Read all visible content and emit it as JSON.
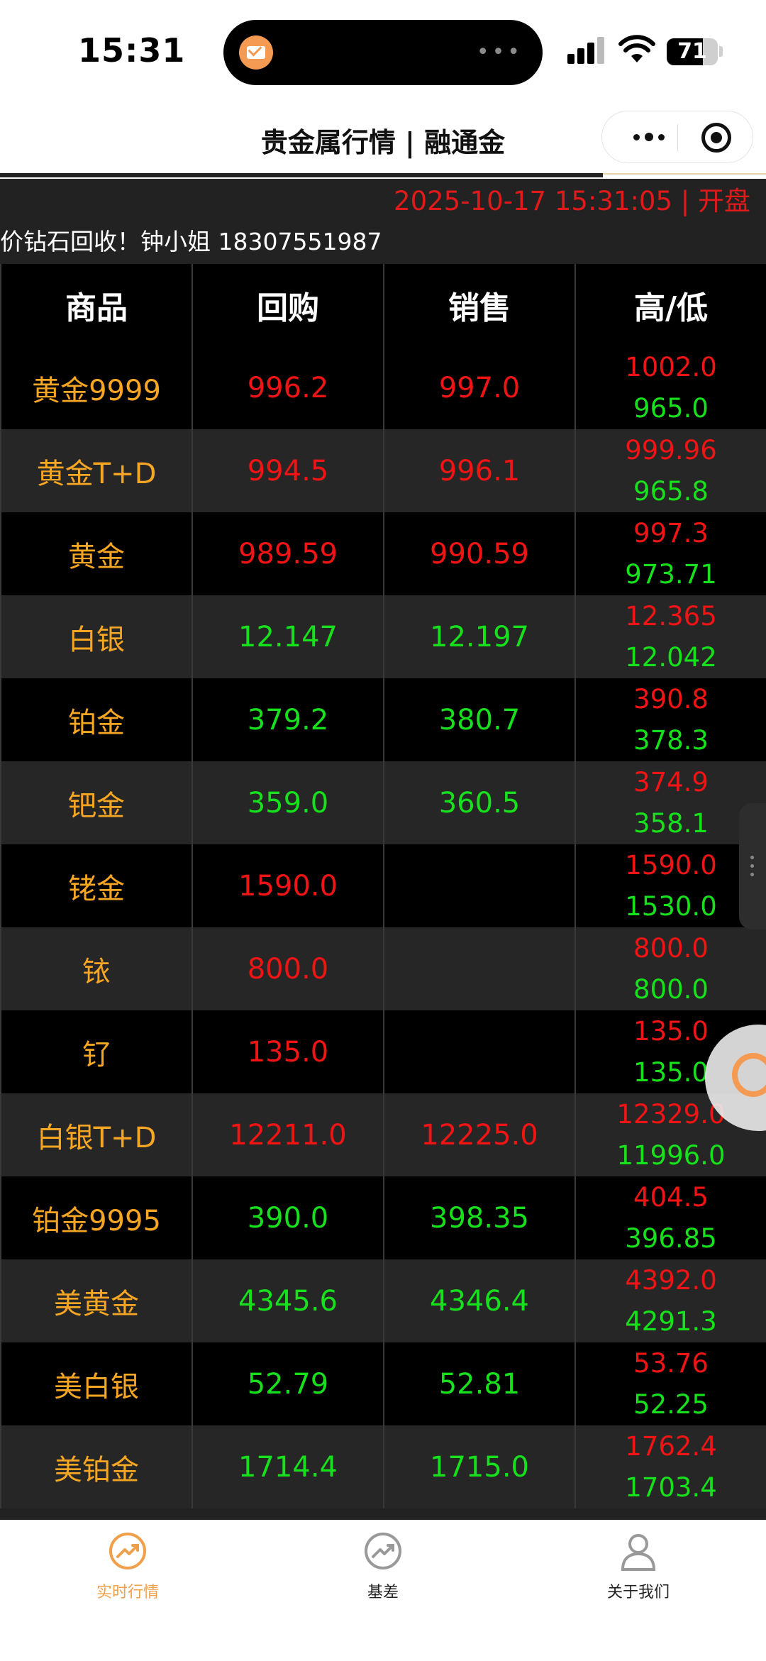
{
  "status_bar": {
    "time": "15:31",
    "battery": "71",
    "island_dots": "•••"
  },
  "header": {
    "title": "贵金属行情 | 融通金"
  },
  "content": {
    "datetime": "2025-10-17 15:31:05 | 开盘",
    "marquee": "价钻石回收！钟小姐 18307551987"
  },
  "table": {
    "headers": [
      "商品",
      "回购",
      "销售",
      "高/低"
    ],
    "rows": [
      {
        "name": "黄金9999",
        "buy": "996.2",
        "buy_color": "red",
        "sell": "997.0",
        "sell_color": "red",
        "high": "1002.0",
        "low": "965.0"
      },
      {
        "name": "黄金T+D",
        "buy": "994.5",
        "buy_color": "red",
        "sell": "996.1",
        "sell_color": "red",
        "high": "999.96",
        "low": "965.8"
      },
      {
        "name": "黄金",
        "buy": "989.59",
        "buy_color": "red",
        "sell": "990.59",
        "sell_color": "red",
        "high": "997.3",
        "low": "973.71"
      },
      {
        "name": "白银",
        "buy": "12.147",
        "buy_color": "green",
        "sell": "12.197",
        "sell_color": "green",
        "high": "12.365",
        "low": "12.042"
      },
      {
        "name": "铂金",
        "buy": "379.2",
        "buy_color": "green",
        "sell": "380.7",
        "sell_color": "green",
        "high": "390.8",
        "low": "378.3"
      },
      {
        "name": "钯金",
        "buy": "359.0",
        "buy_color": "green",
        "sell": "360.5",
        "sell_color": "green",
        "high": "374.9",
        "low": "358.1"
      },
      {
        "name": "铑金",
        "buy": "1590.0",
        "buy_color": "red",
        "sell": "",
        "sell_color": "red",
        "high": "1590.0",
        "low": "1530.0"
      },
      {
        "name": "铱",
        "buy": "800.0",
        "buy_color": "red",
        "sell": "",
        "sell_color": "red",
        "high": "800.0",
        "low": "800.0"
      },
      {
        "name": "钌",
        "buy": "135.0",
        "buy_color": "red",
        "sell": "",
        "sell_color": "red",
        "high": "135.0",
        "low": "135.0"
      },
      {
        "name": "白银T+D",
        "buy": "12211.0",
        "buy_color": "red",
        "sell": "12225.0",
        "sell_color": "red",
        "high": "12329.0",
        "low": "11996.0"
      },
      {
        "name": "铂金9995",
        "buy": "390.0",
        "buy_color": "green",
        "sell": "398.35",
        "sell_color": "green",
        "high": "404.5",
        "low": "396.85"
      },
      {
        "name": "美黄金",
        "buy": "4345.6",
        "buy_color": "green",
        "sell": "4346.4",
        "sell_color": "green",
        "high": "4392.0",
        "low": "4291.3"
      },
      {
        "name": "美白银",
        "buy": "52.79",
        "buy_color": "green",
        "sell": "52.81",
        "sell_color": "green",
        "high": "53.76",
        "low": "52.25"
      },
      {
        "name": "美铂金",
        "buy": "1714.4",
        "buy_color": "green",
        "sell": "1715.0",
        "sell_color": "green",
        "high": "1762.4",
        "low": "1703.4"
      }
    ]
  },
  "tabbar": {
    "tabs": [
      {
        "label": "实时行情",
        "icon": "trend-icon",
        "active": true
      },
      {
        "label": "基差",
        "icon": "trend-icon",
        "active": false
      },
      {
        "label": "关于我们",
        "icon": "user-icon",
        "active": false
      }
    ]
  },
  "colors": {
    "accent": "#f6a623",
    "up": "#f01414",
    "down": "#17e01c",
    "tab_active": "#f0a04b"
  }
}
